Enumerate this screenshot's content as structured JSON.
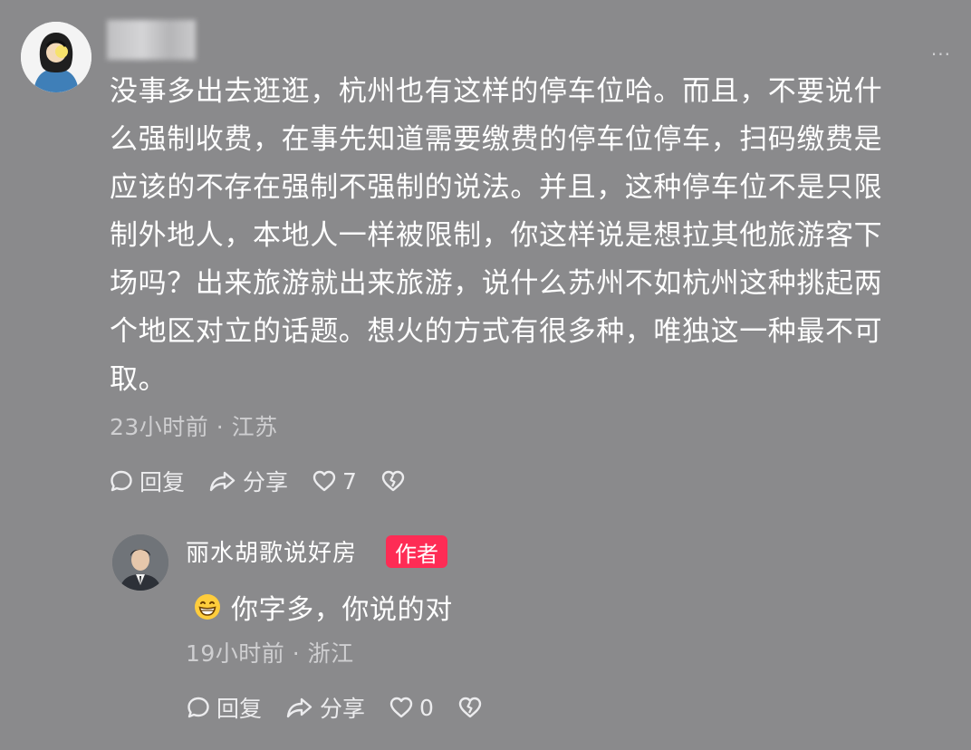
{
  "comment": {
    "lines": [
      "没事多出去逛逛，杭州也有这样的停车位哈。而且，不要说什",
      "么强制收费，在事先知道需要缴费的停车位停车，扫码缴费是",
      "应该的不存在强制不强制的说法。并且，这种停车位不是只限",
      "制外地人，本地人一样被限制，你这样说是想拉其他旅游客下",
      "场吗？出来旅游就出来旅游，说什么苏州不如杭州这种挑起两",
      "个地区对立的话题。想火的方式有很多种，唯独这一种最不可",
      "取。"
    ],
    "meta": "23小时前 · 江苏",
    "reply_label": "回复",
    "share_label": "分享",
    "like_count": "7",
    "more_icon": "ellipsis-icon"
  },
  "reply": {
    "username": "丽水胡歌说好房",
    "badge": "作者",
    "text": "你字多，你说的对",
    "emoji_icon": "grin-emoji-icon",
    "meta": "19小时前 · 浙江",
    "reply_label": "回复",
    "share_label": "分享",
    "like_count": "0"
  },
  "colors": {
    "background": "#8a8a8c",
    "badge": "#fe2c55"
  }
}
